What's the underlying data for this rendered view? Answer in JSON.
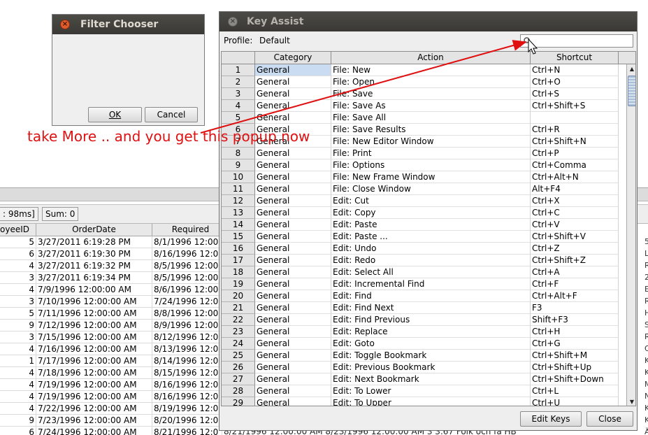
{
  "background": {
    "status": {
      "time": ": 98ms]",
      "sum": "Sum: 0"
    },
    "columns": [
      "oyeeID",
      "OrderDate",
      "Required"
    ],
    "rows": [
      {
        "id": "5",
        "order": "3/27/2011 6:19:28 PM",
        "req": "8/1/1996 12:00"
      },
      {
        "id": "6",
        "order": "3/27/2011 6:19:30 PM",
        "req": "8/16/1996 12:0"
      },
      {
        "id": "4",
        "order": "3/27/2011 6:19:32 PM",
        "req": "8/5/1996 12:00"
      },
      {
        "id": "3",
        "order": "3/27/2011 6:19:34 PM",
        "req": "8/5/1996 12:00"
      },
      {
        "id": "4",
        "order": "7/9/1996 12:00:00 AM",
        "req": "8/6/1996 12:00"
      },
      {
        "id": "3",
        "order": "7/10/1996 12:00:00 AM",
        "req": "7/24/1996 12:0"
      },
      {
        "id": "5",
        "order": "7/11/1996 12:00:00 AM",
        "req": "8/8/1996 12:00"
      },
      {
        "id": "9",
        "order": "7/12/1996 12:00:00 AM",
        "req": "8/9/1996 12:00"
      },
      {
        "id": "3",
        "order": "7/15/1996 12:00:00 AM",
        "req": "8/12/1996 12:0"
      },
      {
        "id": "4",
        "order": "7/16/1996 12:00:00 AM",
        "req": "8/13/1996 12:0"
      },
      {
        "id": "1",
        "order": "7/17/1996 12:00:00 AM",
        "req": "8/14/1996 12:0"
      },
      {
        "id": "4",
        "order": "7/18/1996 12:00:00 AM",
        "req": "8/15/1996 12:0"
      },
      {
        "id": "4",
        "order": "7/19/1996 12:00:00 AM",
        "req": "8/16/1996 12:0"
      },
      {
        "id": "4",
        "order": "7/19/1996 12:00:00 AM",
        "req": "8/16/1996 12:0"
      },
      {
        "id": "4",
        "order": "7/22/1996 12:00:00 AM",
        "req": "8/19/1996 12:0"
      },
      {
        "id": "9",
        "order": "7/23/1996 12:00:00 AM",
        "req": "8/20/1996 12:0"
      },
      {
        "id": "6",
        "order": "7/24/1996 12:00:00 AM",
        "req": "8/21/1996 12:0"
      }
    ],
    "peek_text": "8/21/1996 12:00:00 AM   8/23/1996 12:00:00 AM        3        3.67 Folk och fä HB",
    "right_edge": [
      "5",
      "L",
      "R",
      "2",
      "E",
      "R",
      "H",
      "S",
      "R",
      "Q",
      "K",
      "K",
      "M",
      "N",
      "K",
      "K",
      "Ä"
    ]
  },
  "filter_chooser": {
    "title": "Filter Chooser",
    "ok": "OK",
    "cancel": "Cancel"
  },
  "key_assist": {
    "title": "Key Assist",
    "profile_label": "Profile:",
    "profile_value": "Default",
    "search_placeholder": "",
    "columns": {
      "category": "Category",
      "action": "Action",
      "shortcut": "Shortcut"
    },
    "rows": [
      {
        "n": "1",
        "category": "General",
        "action": "File: New",
        "shortcut": "Ctrl+N"
      },
      {
        "n": "2",
        "category": "General",
        "action": "File: Open",
        "shortcut": "Ctrl+O"
      },
      {
        "n": "3",
        "category": "General",
        "action": "File: Save",
        "shortcut": "Ctrl+S"
      },
      {
        "n": "4",
        "category": "General",
        "action": "File: Save As",
        "shortcut": "Ctrl+Shift+S"
      },
      {
        "n": "5",
        "category": "General",
        "action": "File: Save All",
        "shortcut": ""
      },
      {
        "n": "6",
        "category": "General",
        "action": "File: Save Results",
        "shortcut": "Ctrl+R"
      },
      {
        "n": "7",
        "category": "General",
        "action": "File: New Editor Window",
        "shortcut": "Ctrl+Shift+N"
      },
      {
        "n": "8",
        "category": "General",
        "action": "File: Print",
        "shortcut": "Ctrl+P"
      },
      {
        "n": "9",
        "category": "General",
        "action": "File: Options",
        "shortcut": "Ctrl+Comma"
      },
      {
        "n": "10",
        "category": "General",
        "action": "File: New Frame Window",
        "shortcut": "Ctrl+Alt+N"
      },
      {
        "n": "11",
        "category": "General",
        "action": "File: Close Window",
        "shortcut": "Alt+F4"
      },
      {
        "n": "12",
        "category": "General",
        "action": "Edit: Cut",
        "shortcut": "Ctrl+X"
      },
      {
        "n": "13",
        "category": "General",
        "action": "Edit: Copy",
        "shortcut": "Ctrl+C"
      },
      {
        "n": "14",
        "category": "General",
        "action": "Edit: Paste",
        "shortcut": "Ctrl+V"
      },
      {
        "n": "15",
        "category": "General",
        "action": "Edit: Paste ...",
        "shortcut": "Ctrl+Shift+V"
      },
      {
        "n": "16",
        "category": "General",
        "action": "Edit: Undo",
        "shortcut": "Ctrl+Z"
      },
      {
        "n": "17",
        "category": "General",
        "action": "Edit: Redo",
        "shortcut": "Ctrl+Shift+Z"
      },
      {
        "n": "18",
        "category": "General",
        "action": "Edit: Select All",
        "shortcut": "Ctrl+A"
      },
      {
        "n": "19",
        "category": "General",
        "action": "Edit: Incremental Find",
        "shortcut": "Ctrl+F"
      },
      {
        "n": "20",
        "category": "General",
        "action": "Edit: Find",
        "shortcut": "Ctrl+Alt+F"
      },
      {
        "n": "21",
        "category": "General",
        "action": "Edit: Find Next",
        "shortcut": "F3"
      },
      {
        "n": "22",
        "category": "General",
        "action": "Edit: Find Previous",
        "shortcut": "Shift+F3"
      },
      {
        "n": "23",
        "category": "General",
        "action": "Edit: Replace",
        "shortcut": "Ctrl+H"
      },
      {
        "n": "24",
        "category": "General",
        "action": "Edit: Goto",
        "shortcut": "Ctrl+G"
      },
      {
        "n": "25",
        "category": "General",
        "action": "Edit: Toggle Bookmark",
        "shortcut": "Ctrl+Shift+M"
      },
      {
        "n": "26",
        "category": "General",
        "action": "Edit: Previous Bookmark",
        "shortcut": "Ctrl+Shift+Up"
      },
      {
        "n": "27",
        "category": "General",
        "action": "Edit: Next Bookmark",
        "shortcut": "Ctrl+Shift+Down"
      },
      {
        "n": "28",
        "category": "General",
        "action": "Edit: To Lower",
        "shortcut": "Ctrl+L"
      },
      {
        "n": "29",
        "category": "General",
        "action": "Edit: To Upper",
        "shortcut": "Ctrl+U"
      }
    ],
    "edit_keys": "Edit Keys",
    "close": "Close"
  },
  "annotation": {
    "text": "take More .. and you get this popup now",
    "color": "#e01010"
  },
  "colors": {
    "titlebar": "#3f3e3a",
    "close_button": "#e05b2c",
    "selection": "#c9dcf2"
  }
}
